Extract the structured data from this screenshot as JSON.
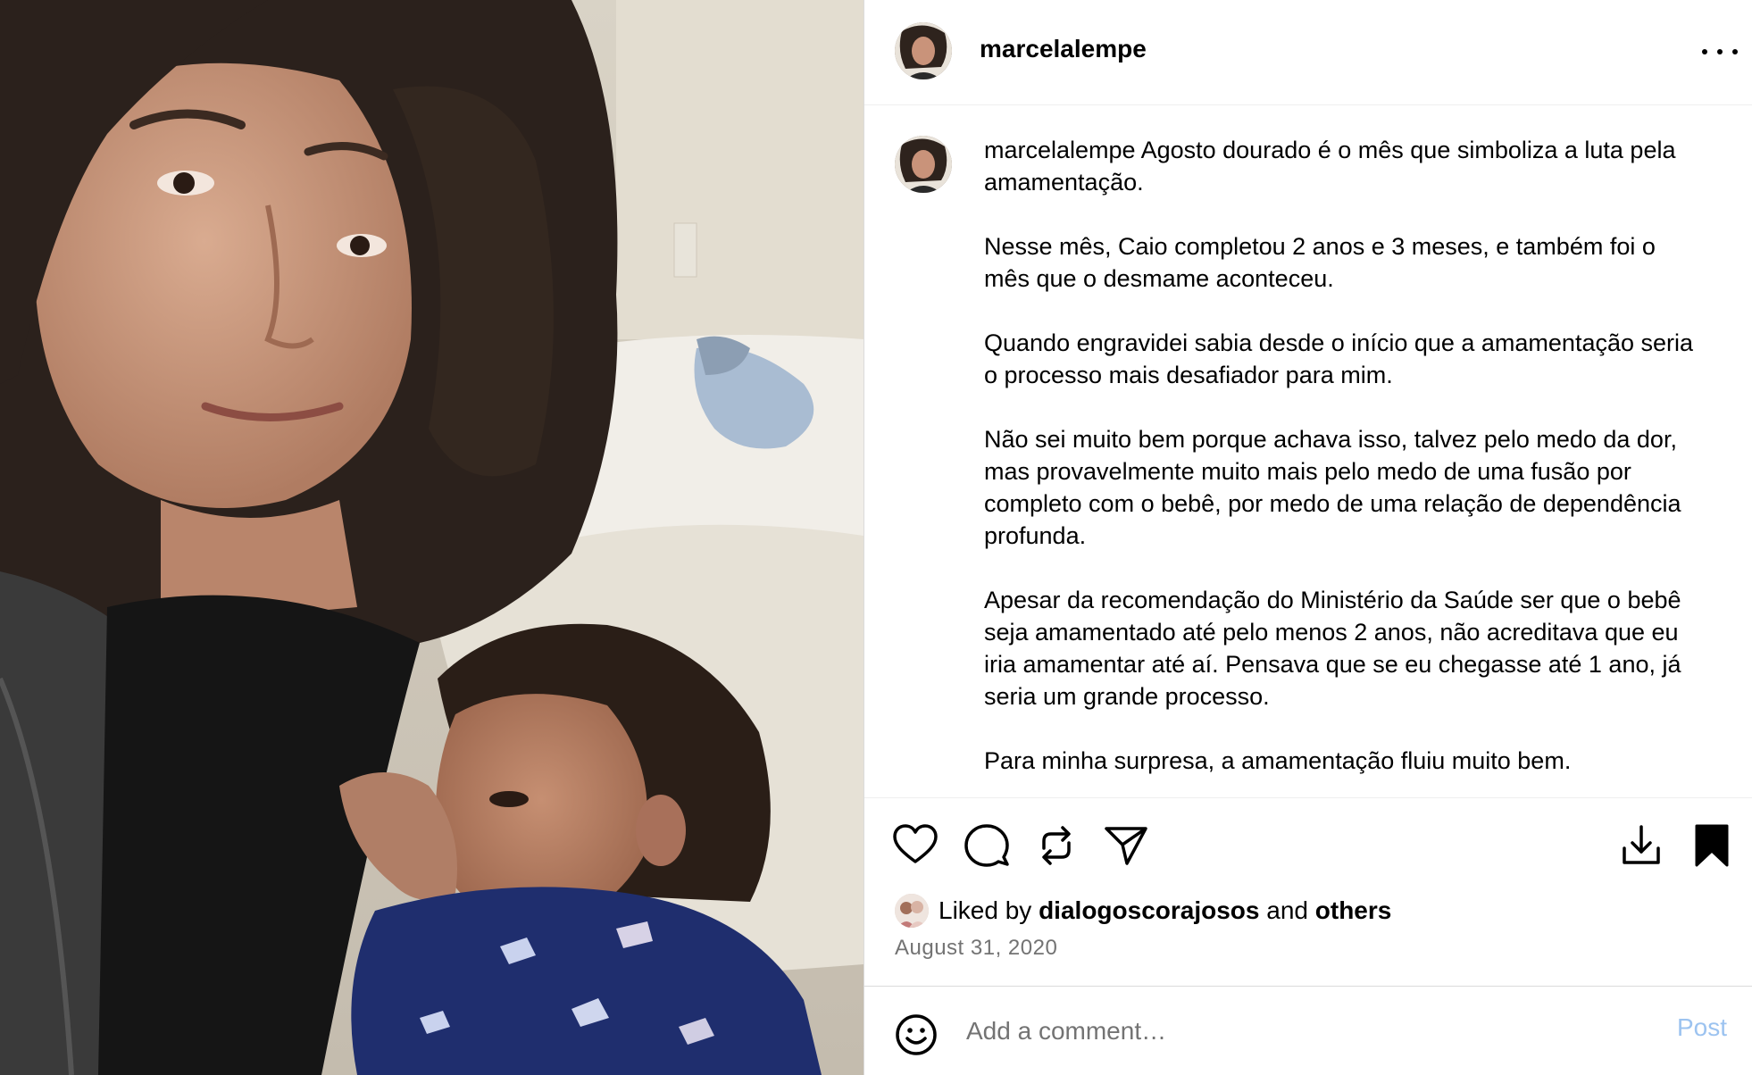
{
  "post": {
    "username": "marcelalempe",
    "more_icon": "more-horizontal-icon",
    "caption": {
      "username": "marcelalempe",
      "first_line": "Agosto dourado é o mês que simboliza a luta pela amamentação.",
      "paragraphs": [
        "Nesse mês, Caio completou 2 anos e 3 meses, e também foi o mês que o desmame aconteceu.",
        "Quando engravidei sabia desde o início que a amamentação seria o processo mais desafiador para mim.",
        "Não sei muito bem porque achava isso, talvez pelo medo da dor, mas provavelmente muito mais pelo medo de uma fusão por completo com o bebê, por medo de uma relação de dependência profunda.",
        "Apesar da recomendação do Ministério da Saúde ser que o bebê seja amamentado até pelo menos 2 anos, não acreditava que eu iria amamentar até aí. Pensava que se eu chegasse até 1 ano, já seria um grande processo.",
        "Para minha surpresa, a amamentação fluiu muito bem."
      ]
    },
    "actions": {
      "like_icon": "heart-icon",
      "comment_icon": "comment-icon",
      "repost_icon": "repost-icon",
      "share_icon": "send-icon",
      "download_icon": "download-icon",
      "save_icon": "bookmark-filled-icon"
    },
    "likes": {
      "prefix": "Liked by",
      "user": "dialogoscorajosos",
      "joiner": "and",
      "others": "others"
    },
    "date": "August 31, 2020",
    "comment": {
      "placeholder": "Add a comment…",
      "value": "",
      "post_label": "Post",
      "emoji_icon": "emoji-smile-icon"
    },
    "colors": {
      "post_button": "#9cc3f0",
      "muted_text": "#737373",
      "divider": "#dbdbdb"
    }
  }
}
